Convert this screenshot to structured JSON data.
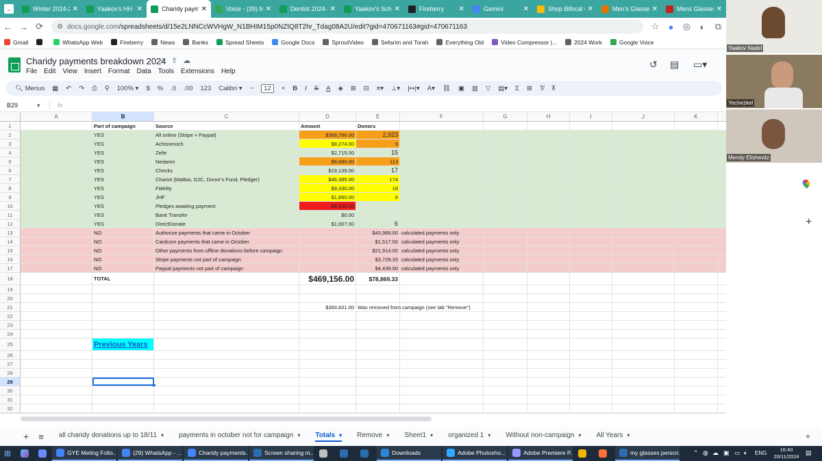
{
  "browser": {
    "tabs": [
      {
        "label": "Winter 2024-2",
        "color": "#0f9d58"
      },
      {
        "label": "Yaakov's HH C",
        "color": "#0f9d58"
      },
      {
        "label": "Charidy payme",
        "color": "#0f9d58",
        "active": true
      },
      {
        "label": "Voice - (39) Mi",
        "color": "#34a853"
      },
      {
        "label": "Dentist 2024-2",
        "color": "#0f9d58"
      },
      {
        "label": "Yaakov's Sche",
        "color": "#0f9d58"
      },
      {
        "label": "Fireberry",
        "color": "#202124"
      },
      {
        "label": "Gemini",
        "color": "#4285f4"
      },
      {
        "label": "Shop Bifocal G",
        "color": "#fbbc04"
      },
      {
        "label": "Men's Glasses",
        "color": "#e37400"
      },
      {
        "label": "Mens Glasses",
        "color": "#c5221f"
      }
    ],
    "url_prefix": "docs.google.com",
    "url": "/spreadsheets/d/15e2LNNCcWVHgW_N1BHIM15p0NZtQ8T2hr_Tdag08A2U/edit?gid=470671163#gid=470671163",
    "bookmarks": [
      {
        "label": "Gmail",
        "color": "#ea4335"
      },
      {
        "label": "",
        "color": "#202124"
      },
      {
        "label": "WhatsApp Web",
        "color": "#25d366"
      },
      {
        "label": "Fireberry",
        "color": "#202124"
      },
      {
        "label": "News",
        "color": "#5f6368"
      },
      {
        "label": "Banks",
        "color": "#5f6368"
      },
      {
        "label": "Spread Sheets",
        "color": "#0f9d58"
      },
      {
        "label": "Google Docs",
        "color": "#4285f4"
      },
      {
        "label": "SproutVideo",
        "color": "#5f6368"
      },
      {
        "label": "Sefarim and Torah",
        "color": "#5f6368"
      },
      {
        "label": "Everything Old",
        "color": "#5f6368"
      },
      {
        "label": "Video Compressor |...",
        "color": "#7e57c2"
      },
      {
        "label": "2024 Work",
        "color": "#5f6368"
      },
      {
        "label": "Google Voice",
        "color": "#34a853"
      }
    ]
  },
  "doc": {
    "title": "Charidy payments breakdown 2024",
    "menus": [
      "File",
      "Edit",
      "View",
      "Insert",
      "Format",
      "Data",
      "Tools",
      "Extensions",
      "Help"
    ]
  },
  "toolbar": {
    "menus_label": "Menus",
    "zoom": "100%",
    "currency": "$",
    "percent": "%",
    "dec_dec": ".0",
    "dec_inc": ".00",
    "number_format": "123",
    "font": "Calibri",
    "font_size": "12",
    "bold": "B",
    "italic": "I",
    "strike": "S",
    "text_color": "A"
  },
  "formula_bar": {
    "cell_ref": "B29",
    "fx": "fx"
  },
  "grid": {
    "columns": [
      "A",
      "B",
      "C",
      "D",
      "E",
      "F",
      "G",
      "H",
      "I",
      "J",
      "K"
    ],
    "rows": [
      {
        "n": "1",
        "b": "Part of campaign",
        "c": "Source",
        "d": "Amount",
        "e": "Donors",
        "f": "",
        "bold": true,
        "bg": "#ffffff"
      },
      {
        "n": "2",
        "b": "YES",
        "c": "All online (Stripe + Paypal)",
        "d": "$366,766.00",
        "e": "2,923",
        "f": "",
        "bg": "#d9ead3",
        "dbg": "#f6a01a",
        "ebg": "#f6a01a",
        "efs": "big"
      },
      {
        "n": "3",
        "b": "YES",
        "c": "Achisomoch",
        "d": "$8,274.00",
        "e": "9",
        "f": "",
        "bg": "#d9ead3",
        "dbg": "#ffff00",
        "ebg": "#f6a01a"
      },
      {
        "n": "4",
        "b": "YES",
        "c": "Zelle",
        "d": "$2,715.00",
        "e": "15",
        "f": "",
        "bg": "#d9ead3",
        "efs": "big"
      },
      {
        "n": "5",
        "b": "YES",
        "c": "Nedarim",
        "d": "$8,880.00",
        "e": "113",
        "f": "",
        "bg": "#d9ead3",
        "dbg": "#f6a01a",
        "ebg": "#f6a01a"
      },
      {
        "n": "6",
        "b": "YES",
        "c": "Checks",
        "d": "$19,139.00",
        "e": "17",
        "f": "",
        "bg": "#d9ead3",
        "efs": "big"
      },
      {
        "n": "7",
        "b": "YES",
        "c": "Chariot (Matbia, OJC, Donor's Fund, Pledger)",
        "d": "$46,385.00",
        "e": "174",
        "f": "",
        "bg": "#d9ead3",
        "dbg": "#ffff00",
        "ebg": "#ffff00"
      },
      {
        "n": "8",
        "b": "YES",
        "c": "Fidelity",
        "d": "$9,330.00",
        "e": "18",
        "f": "",
        "bg": "#d9ead3",
        "dbg": "#ffff00",
        "ebg": "#ffff00"
      },
      {
        "n": "9",
        "b": "YES",
        "c": "JHF",
        "d": "$1,860.00",
        "e": "6",
        "f": "",
        "bg": "#d9ead3",
        "dbg": "#ffff00",
        "ebg": "#ffff00"
      },
      {
        "n": "10",
        "b": "YES",
        "c": "Pledges awaiting payment",
        "d": "$4,400.00",
        "e": "",
        "f": "",
        "bg": "#d9ead3",
        "dbg": "#ee1c1c"
      },
      {
        "n": "11",
        "b": "YES",
        "c": "Bank Transfer",
        "d": "$0.00",
        "e": "",
        "f": "",
        "bg": "#d9ead3"
      },
      {
        "n": "12",
        "b": "YES",
        "c": "DirectDonate",
        "d": "$1,007.00",
        "e": "6",
        "f": "",
        "bg": "#d9ead3",
        "efs": "big"
      },
      {
        "n": "13",
        "b": "NO",
        "c": "Authorize payments that came in October",
        "d": "",
        "e": "$43,989.00",
        "f": "calculated payments only",
        "bg": "#f4cccc"
      },
      {
        "n": "14",
        "b": "NO",
        "c": "Cardcom payments that came in October",
        "d": "",
        "e": "$1,517.00",
        "f": "calculated payments only",
        "bg": "#f4cccc"
      },
      {
        "n": "15",
        "b": "NO",
        "c": "Other payments from offline donations before campaign",
        "d": "",
        "e": "$21,914.00",
        "f": "calculated payments only",
        "bg": "#f4cccc"
      },
      {
        "n": "16",
        "b": "NO",
        "c": "Stripe payments not part of campaign",
        "d": "",
        "e": "$3,729.33",
        "f": "calculated payments only",
        "bg": "#f4cccc"
      },
      {
        "n": "17",
        "b": "NO",
        "c": "Paypal payments not part of campaign",
        "d": "",
        "e": "$4,439.00",
        "f": "calculated payments only",
        "bg": "#f4cccc"
      },
      {
        "n": "18",
        "b": "TOTAL",
        "c": "",
        "d": "$469,156.00",
        "e": "$78,869.33",
        "f": "",
        "bold": true,
        "bg": "#ffffff",
        "tall": true
      },
      {
        "n": "19",
        "b": "",
        "c": "",
        "d": "",
        "e": "",
        "f": "",
        "bg": "#ffffff"
      },
      {
        "n": "20",
        "b": "",
        "c": "",
        "d": "",
        "e": "",
        "f": "",
        "bg": "#ffffff"
      },
      {
        "n": "21",
        "b": "",
        "c": "",
        "d": "$393,601.00",
        "e": "Was removed from campaign (see tab \"Remove\")",
        "f": "",
        "bg": "#ffffff",
        "eleft": true
      },
      {
        "n": "22",
        "b": "",
        "c": "",
        "d": "",
        "e": "",
        "f": "",
        "bg": "#ffffff"
      },
      {
        "n": "23",
        "b": "",
        "c": "",
        "d": "",
        "e": "",
        "f": "",
        "bg": "#ffffff"
      },
      {
        "n": "24",
        "b": "",
        "c": "",
        "d": "",
        "e": "",
        "f": "",
        "bg": "#ffffff"
      },
      {
        "n": "25",
        "b": "Previous Years",
        "c": "",
        "d": "",
        "e": "",
        "f": "",
        "bg": "#ffffff",
        "link": true,
        "tall": true
      },
      {
        "n": "26",
        "b": "",
        "c": "",
        "d": "",
        "e": "",
        "f": "",
        "bg": "#ffffff"
      },
      {
        "n": "27",
        "b": "",
        "c": "",
        "d": "",
        "e": "",
        "f": "",
        "bg": "#ffffff"
      },
      {
        "n": "28",
        "b": "",
        "c": "",
        "d": "",
        "e": "",
        "f": "",
        "bg": "#ffffff"
      },
      {
        "n": "29",
        "b": "",
        "c": "",
        "d": "",
        "e": "",
        "f": "",
        "bg": "#ffffff",
        "selected": true
      },
      {
        "n": "30",
        "b": "",
        "c": "",
        "d": "",
        "e": "",
        "f": "",
        "bg": "#ffffff"
      },
      {
        "n": "31",
        "b": "",
        "c": "",
        "d": "",
        "e": "",
        "f": "",
        "bg": "#ffffff"
      },
      {
        "n": "32",
        "b": "",
        "c": "",
        "d": "",
        "e": "",
        "f": "",
        "bg": "#ffffff"
      },
      {
        "n": "33",
        "b": "",
        "c": "",
        "d": "",
        "e": "",
        "f": "",
        "bg": "#ffffff"
      }
    ]
  },
  "sheet_tabs": [
    {
      "label": "all charidy donations up to 18/11",
      "active": false
    },
    {
      "label": "payments in october not for campaign",
      "active": false
    },
    {
      "label": "Totals",
      "active": true
    },
    {
      "label": "Remove",
      "active": false
    },
    {
      "label": "Sheet1",
      "active": false
    },
    {
      "label": "organized 1",
      "active": false
    },
    {
      "label": "Without non-campaign",
      "active": false
    },
    {
      "label": "All Years",
      "active": false
    }
  ],
  "participants": [
    {
      "name": "Yaakov Nadel"
    },
    {
      "name": "Yechezkel"
    },
    {
      "name": "Mendy Elishevitz"
    }
  ],
  "taskbar": {
    "items": [
      {
        "label": "GYE Meting Follo...",
        "color": "#4285f4"
      },
      {
        "label": "(29) WhatsApp - ...",
        "color": "#4285f4"
      },
      {
        "label": "Charidy payments...",
        "color": "#4285f4"
      },
      {
        "label": "Screen sharing m...",
        "color": "#2b6cb0"
      },
      {
        "label": "",
        "color": "#c0c0c0"
      },
      {
        "label": "",
        "color": "#2b6cb0"
      },
      {
        "label": "",
        "color": "#2b6cb0"
      },
      {
        "label": "Downloads",
        "color": "#2b88d8"
      },
      {
        "label": "Adobe Photosho...",
        "color": "#31a8ff"
      },
      {
        "label": "Adobe Premiere P...",
        "color": "#9999ff"
      },
      {
        "label": "",
        "color": "#f2b705"
      },
      {
        "label": "",
        "color": "#ff7139"
      },
      {
        "label": "my glasses perscri...",
        "color": "#2b6cb0"
      }
    ],
    "lang": "ENG",
    "time": "16:40",
    "date": "20/11/2024"
  }
}
